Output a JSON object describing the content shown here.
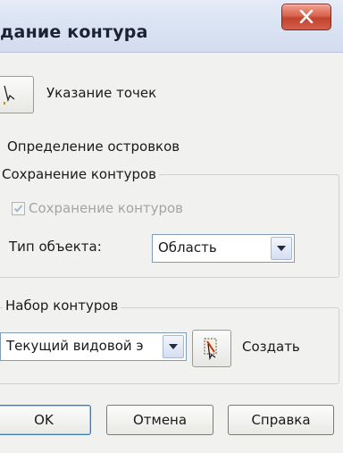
{
  "window": {
    "title": "дание контура"
  },
  "pick_points": {
    "label": "Указание точек"
  },
  "island_detection": {
    "label": "Определение островков"
  },
  "retain": {
    "group_title": "Сохранение контуров",
    "checkbox_label": "Сохранение контуров",
    "checkbox_checked": true,
    "checkbox_disabled": true,
    "object_type_label": "Тип объекта:",
    "object_type_value": "Область"
  },
  "boundary_set": {
    "group_title": "Набор контуров",
    "value": "Текущий видовой э",
    "new_label": "Создать"
  },
  "buttons": {
    "ok": "OK",
    "cancel": "Отмена",
    "help": "Справка"
  },
  "colors": {
    "title_bg": "#dbe4f3",
    "close_red": "#c0432e",
    "dialog_bg": "#f1f1ef"
  }
}
